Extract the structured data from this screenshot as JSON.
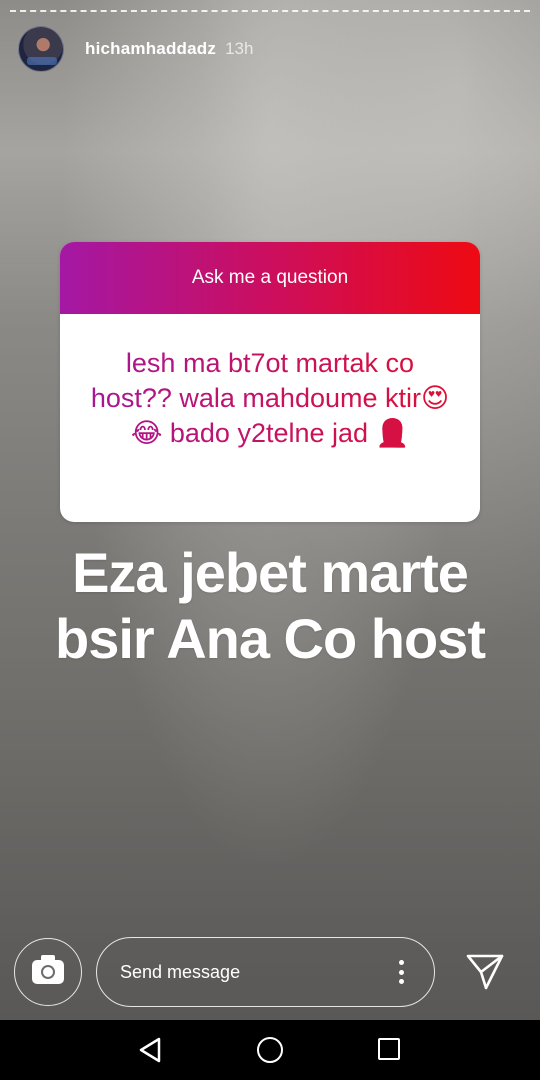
{
  "story": {
    "username": "hichamhaddadz",
    "time_ago": "13h"
  },
  "question_sticker": {
    "title": "Ask me a question",
    "answer": "lesh ma bt7ot martak co host?? wala mahdoume ktir😍😂 bado y2telne jad 🤦🏼‍♀️"
  },
  "overlay_text": {
    "line1": "Eza jebet marte",
    "line2": "bsir Ana Co host"
  },
  "reply_bar": {
    "placeholder": "Send message",
    "camera_icon": "camera-icon",
    "more_icon": "more-vertical-icon",
    "send_icon": "send-icon"
  },
  "nav_bar": {
    "back_icon": "back-triangle-icon",
    "home_icon": "home-circle-icon",
    "recents_icon": "recents-square-icon"
  },
  "colors": {
    "sticker_gradient_start": "#a418a4",
    "sticker_gradient_end": "#ee0a12",
    "text_white": "#ffffff"
  }
}
